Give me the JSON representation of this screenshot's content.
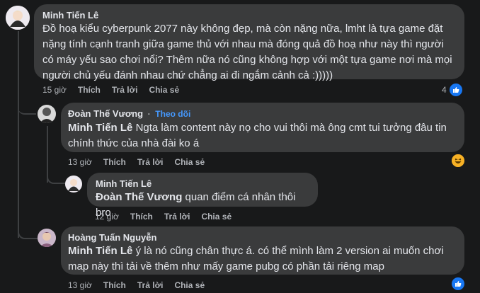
{
  "comments": [
    {
      "author": "Minh Tiến Lê",
      "lines": [
        "Đồ hoạ kiểu cyberpunk 2077 này không đẹp, mà còn nặng nữa, lmht là tựa game đặt",
        "nặng tính cạnh tranh giữa game thủ với nhau mà đóng quả đồ hoạ như này thì người",
        "có máy yếu sao chơi nổi? Thêm nữa nó cũng không hợp với một tựa game nơi mà mọi",
        "người chủ yếu đánh nhau chứ chẳng ai đi ngắm cảnh cả :)))))"
      ],
      "time": "15 giờ",
      "like": "Thích",
      "reply": "Trả lời",
      "share": "Chia sẻ",
      "reaction_count": "4"
    },
    {
      "author": "Đoàn Thế Vương",
      "follow_sep": "·",
      "follow": "Theo dõi",
      "mention": "Minh Tiến Lê",
      "line1": "Ngta làm content này nọ cho vui thôi mà ông cmt tui tưởng đâu tin",
      "line2": "chính thức của nhà đài ko á",
      "time": "13 giờ",
      "like": "Thích",
      "reply": "Trả lời",
      "share": "Chia sẻ"
    },
    {
      "author": "Minh Tiến Lê",
      "mention": "Đoàn Thế Vương",
      "text": "quan điểm cá nhân thôi bro",
      "time": "12 giờ",
      "like": "Thích",
      "reply": "Trả lời",
      "share": "Chia sẻ"
    },
    {
      "author": "Hoàng Tuấn Nguyễn",
      "mention": "Minh Tiến Lê",
      "line1": "ý là nó cũng chân thực á. có thể mình làm 2 version ai muốn chơi",
      "line2": "map này thì tải về thêm như mấy game pubg có phần tải riêng map",
      "time": "13 giờ",
      "like": "Thích",
      "reply": "Trả lời",
      "share": "Chia sẻ"
    }
  ],
  "colors": {
    "background": "#18191a",
    "bubble": "#3a3b3c",
    "link": "#4599ff",
    "like": "#1877f2",
    "haha": "#f7b125"
  }
}
